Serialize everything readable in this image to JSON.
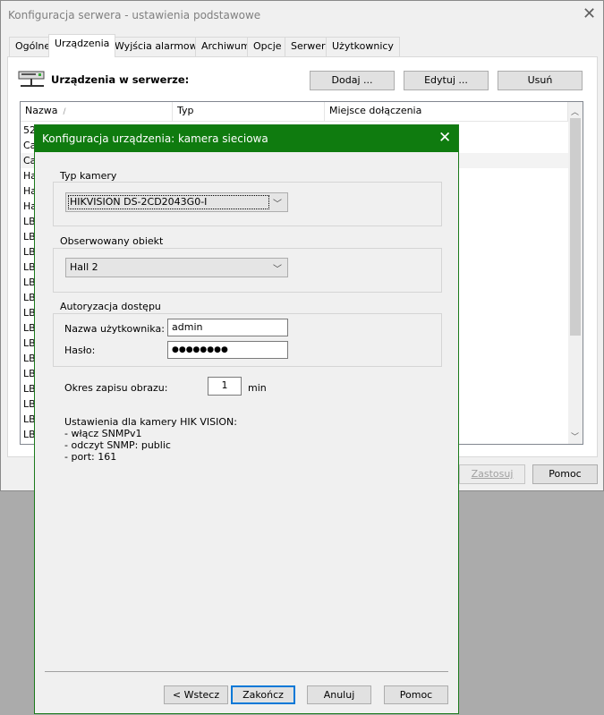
{
  "back_window": {
    "title": "Konfiguracja serwera - ustawienia podstawowe",
    "tabs": [
      "Ogólne",
      "Urządzenia",
      "Wyjścia alarmowe",
      "Archiwum",
      "Opcje",
      "Serwer",
      "Użytkownicy"
    ],
    "active_tab": "Urządzenia",
    "section_title": "Urządzenia w serwerze:",
    "buttons": {
      "add": "Dodaj ...",
      "edit": "Edytuj ...",
      "remove": "Usuń",
      "apply": "Zastosuj",
      "help": "Pomoc"
    },
    "list": {
      "columns": [
        "Nazwa",
        "Typ",
        "Miejsce dołączenia"
      ],
      "rows": [
        "52",
        "Ca",
        "Ca",
        "Ha",
        "Ha",
        "Ha",
        "LB",
        "LB",
        "LB",
        "LB",
        "LB",
        "LB",
        "LB",
        "LB",
        "LB",
        "LB",
        "LB",
        "LB",
        "LB",
        "LB",
        "LB"
      ]
    }
  },
  "dialog": {
    "title": "Konfiguracja urządzenia: kamera sieciowa",
    "camera_type": {
      "label": "Typ kamery",
      "value": "HIKVISION DS-2CD2043G0-I"
    },
    "observed_object": {
      "label": "Obserwowany obiekt",
      "value": "Hall 2"
    },
    "auth": {
      "label": "Autoryzacja dostępu",
      "user_label": "Nazwa użytkownika:",
      "user_value": "admin",
      "password_label": "Hasło:",
      "password_value": "●●●●●●●●"
    },
    "record_period": {
      "label": "Okres zapisu obrazu:",
      "value": "1",
      "unit": "min"
    },
    "info": [
      "Ustawienia dla kamery HIK VISION:",
      "- włącz SNMPv1",
      "- odczyt SNMP: public",
      "- port: 161"
    ],
    "buttons": {
      "back": "< Wstecz",
      "finish": "Zakończ",
      "cancel": "Anuluj",
      "help": "Pomoc"
    }
  }
}
